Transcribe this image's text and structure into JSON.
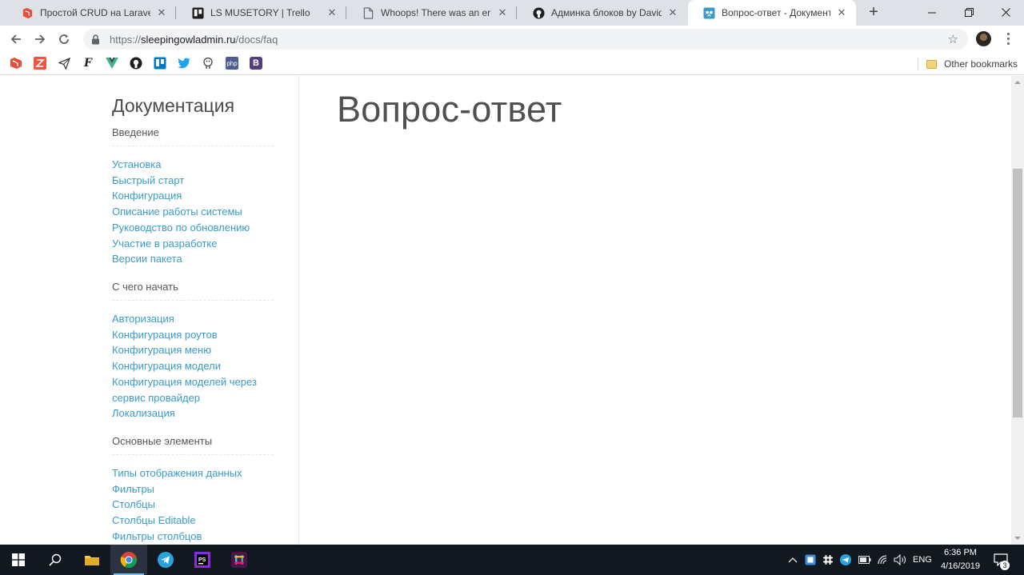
{
  "browser": {
    "tabs": [
      {
        "title": "Простой CRUD на Laravel + Sl",
        "favicon": "laravel-icon",
        "color": "#e94d3b"
      },
      {
        "title": "LS MUSETORY | Trello",
        "favicon": "trello-icon",
        "color": "#1d1d1d"
      },
      {
        "title": "Whoops! There was an error.",
        "favicon": "page-icon",
        "color": "#5f6368"
      },
      {
        "title": "Админка блоков by Davidnad",
        "favicon": "github-icon",
        "color": "#1d1d1d"
      },
      {
        "title": "Вопрос-ответ - Документация",
        "favicon": "sleepingowl-icon",
        "color": "#3a9bc8"
      }
    ],
    "active_tab_index": 4,
    "url": {
      "scheme": "https://",
      "host": "sleepingowladmin.ru",
      "path": "/docs/faq"
    },
    "bookmarks": [
      {
        "icon": "laravel-icon",
        "color": "#e94d3b"
      },
      {
        "icon": "laravel-alt-icon",
        "color": "#f05340"
      },
      {
        "icon": "paper-plane-icon",
        "color": "#333333"
      },
      {
        "icon": "f-logo-icon",
        "color": "#222222"
      },
      {
        "icon": "vue-icon",
        "color": "#41b883"
      },
      {
        "icon": "github-icon",
        "color": "#1d1d1d"
      },
      {
        "icon": "trello-icon",
        "color": "#0079bf"
      },
      {
        "icon": "twitter-icon",
        "color": "#1da1f2"
      },
      {
        "icon": "elephant-icon",
        "color": "#444444"
      },
      {
        "icon": "php-icon",
        "color": "#4f5b93"
      },
      {
        "icon": "bootstrap-icon",
        "color": "#563d7c"
      }
    ],
    "other_bookmarks": "Other bookmarks"
  },
  "page": {
    "sidebar": {
      "title": "Документация",
      "sections": [
        {
          "title": "Введение",
          "links": [
            "Установка",
            "Быстрый старт",
            "Конфигурация",
            "Описание работы системы",
            "Руководство по обновлению",
            "Участие в разработке",
            "Версии пакета"
          ]
        },
        {
          "title": "С чего начать",
          "links": [
            "Авторизация",
            "Конфигурация роутов",
            "Конфигурация меню",
            "Конфигурация модели",
            "Конфигурация моделей через",
            "сервис провайдер",
            "Локализация"
          ]
        },
        {
          "title": "Основные элементы",
          "links": [
            "Типы отображения данных",
            "Фильтры",
            "Столбцы",
            "Столбцы Editable",
            "Фильтры столбцов"
          ]
        }
      ]
    },
    "main": {
      "title": "Вопрос-ответ"
    }
  },
  "taskbar": {
    "apps": [
      {
        "name": "file-explorer-icon",
        "color": "#f2c94c"
      },
      {
        "name": "chrome-icon",
        "color": "#db4437"
      },
      {
        "name": "telegram-icon",
        "color": "#2aa3dc"
      },
      {
        "name": "phpstorm-icon",
        "color": "#8a2be2"
      },
      {
        "name": "slack-icon",
        "color": "#4a154b"
      }
    ],
    "active_app_index": 1,
    "language": "ENG",
    "time": "6:36 PM",
    "date": "4/16/2019",
    "notifications_count": "3"
  },
  "colors": {
    "link": "#3a9bc8",
    "title": "#505050"
  }
}
